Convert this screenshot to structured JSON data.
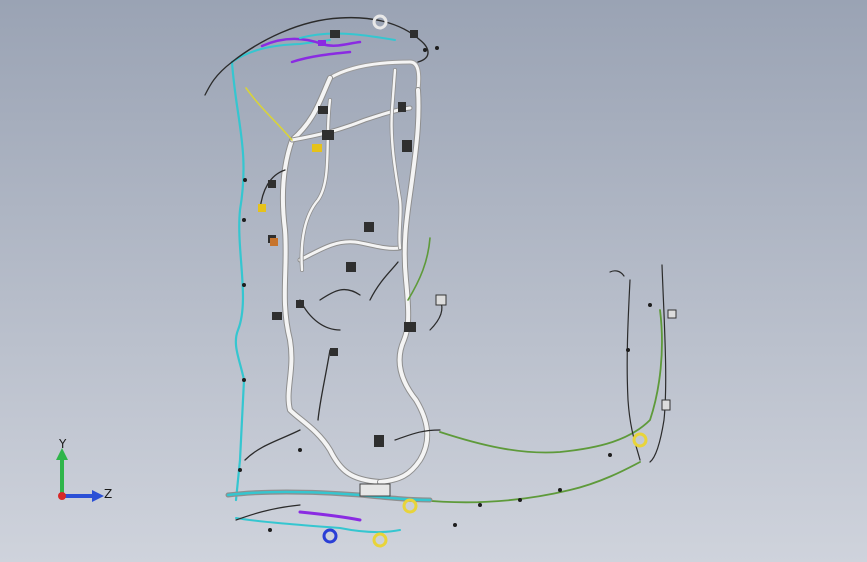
{
  "viewport": {
    "background_top": "#9aa3b4",
    "background_bottom": "#cfd3dc"
  },
  "triad": {
    "y_label": "Y",
    "z_label": "Z",
    "y_color": "#2fb54a",
    "z_color": "#2a4fd6",
    "x_color": "#d62828"
  },
  "model": {
    "wire_colors": {
      "main_trunk": "#f4f4f4",
      "cyan_branch": "#35c6d0",
      "green_branch": "#5e9a3a",
      "purple_branch": "#8a2be2",
      "yellow_branch": "#d8d33a",
      "dark_wire": "#2b2b2b"
    }
  }
}
